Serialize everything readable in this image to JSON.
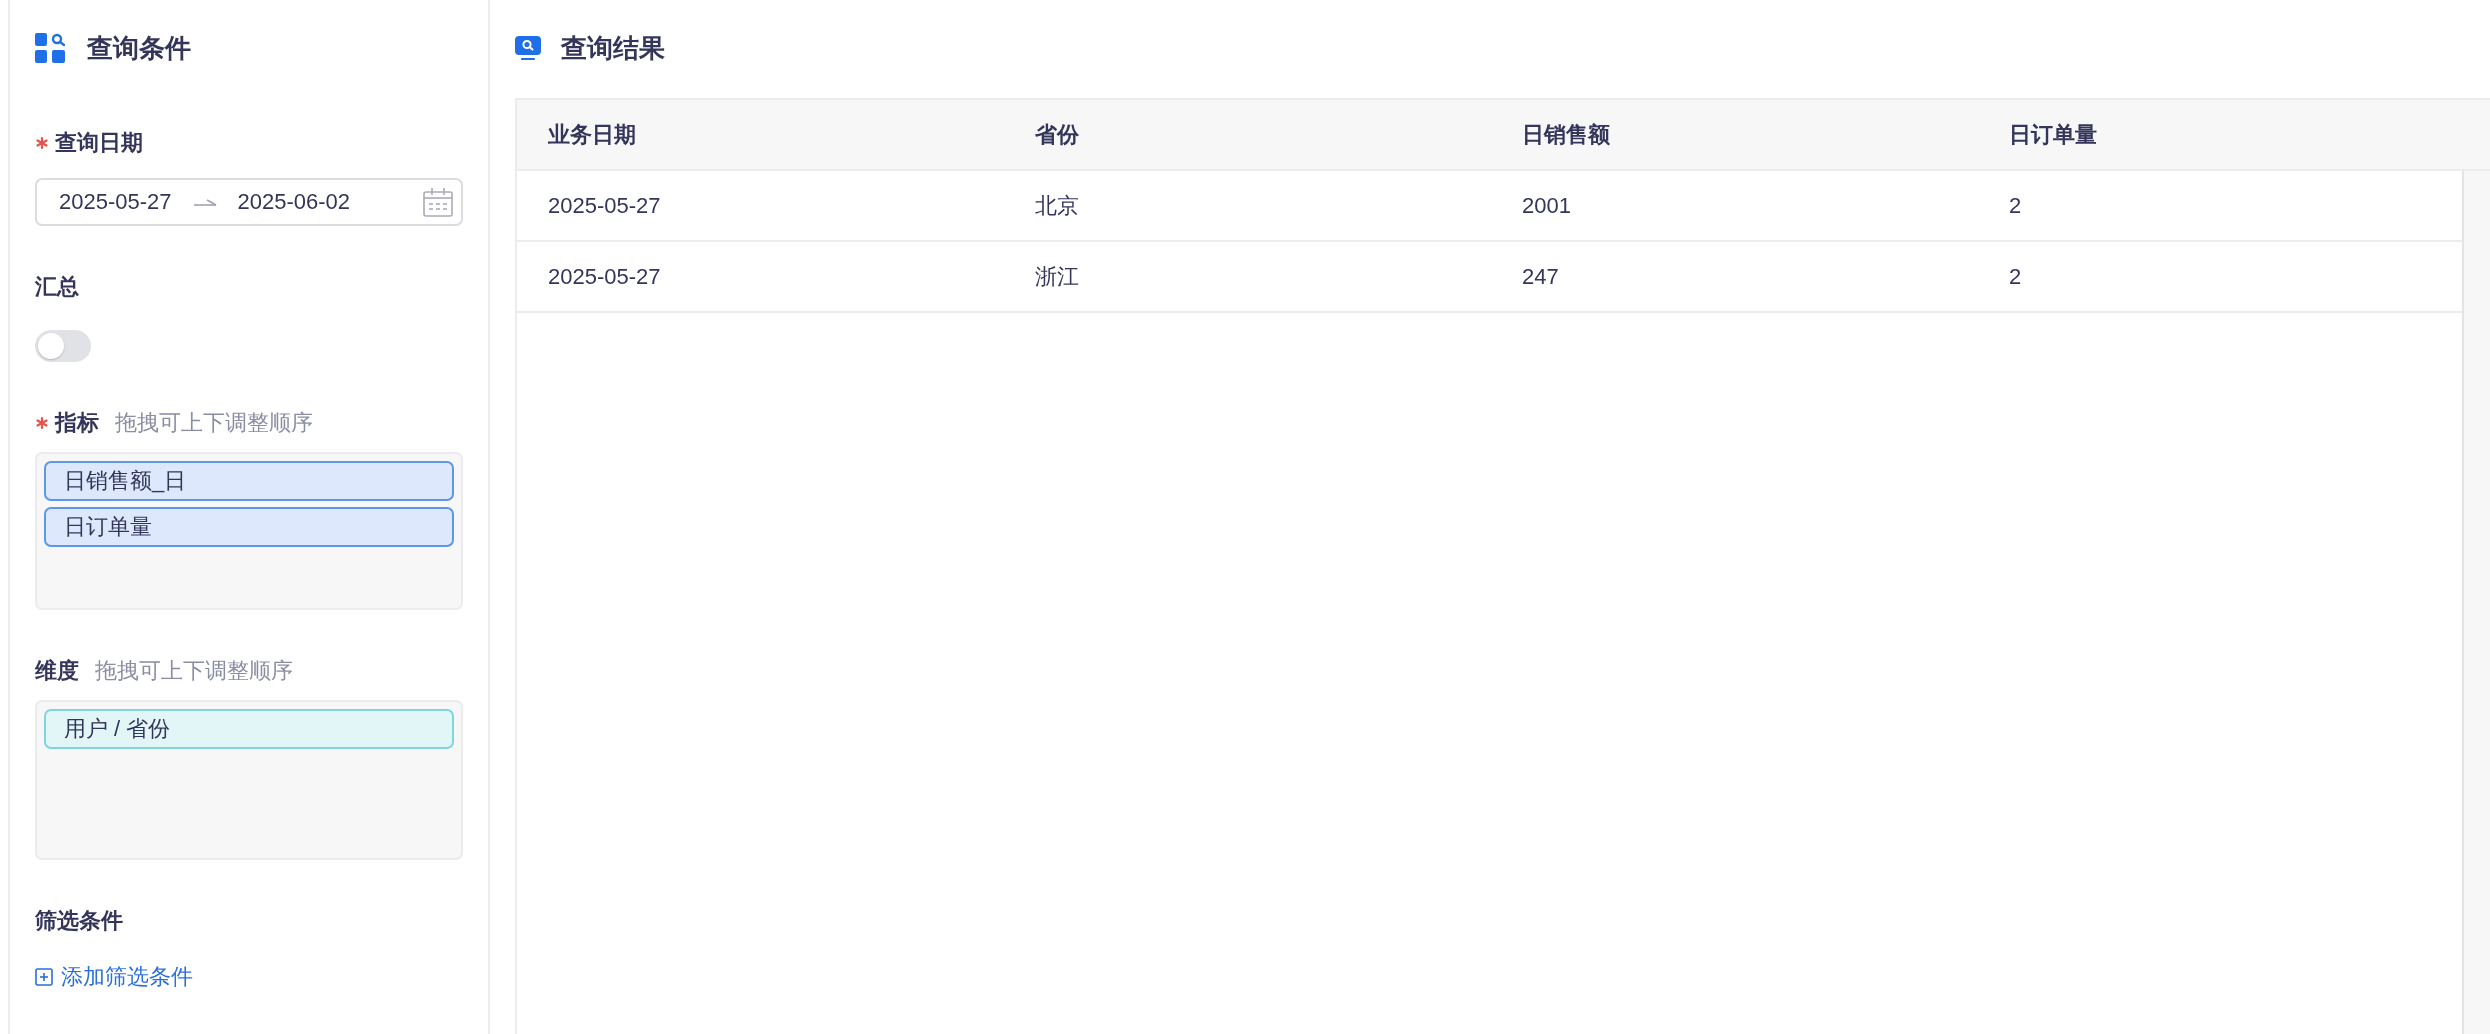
{
  "query_panel": {
    "title": "查询条件",
    "date_field": {
      "label": "查询日期",
      "required": true,
      "start": "2025-05-27",
      "end": "2025-06-02"
    },
    "summary": {
      "label": "汇总",
      "on": false
    },
    "metrics": {
      "label": "指标",
      "required": true,
      "hint": "拖拽可上下调整顺序",
      "items": [
        {
          "label": "日销售额_日",
          "kind": "metric"
        },
        {
          "label": "日订单量",
          "kind": "metric"
        }
      ]
    },
    "dimensions": {
      "label": "维度",
      "hint": "拖拽可上下调整顺序",
      "items": [
        {
          "label": "用户 / 省份",
          "kind": "dimension"
        }
      ]
    },
    "filters": {
      "label": "筛选条件",
      "add_link": "添加筛选条件"
    }
  },
  "results_panel": {
    "title": "查询结果",
    "table": {
      "columns": [
        "业务日期",
        "省份",
        "日销售额",
        "日订单量"
      ],
      "rows": [
        [
          "2025-05-27",
          "北京",
          "2001",
          "2"
        ],
        [
          "2025-05-27",
          "浙江",
          "247",
          "2"
        ]
      ]
    }
  }
}
